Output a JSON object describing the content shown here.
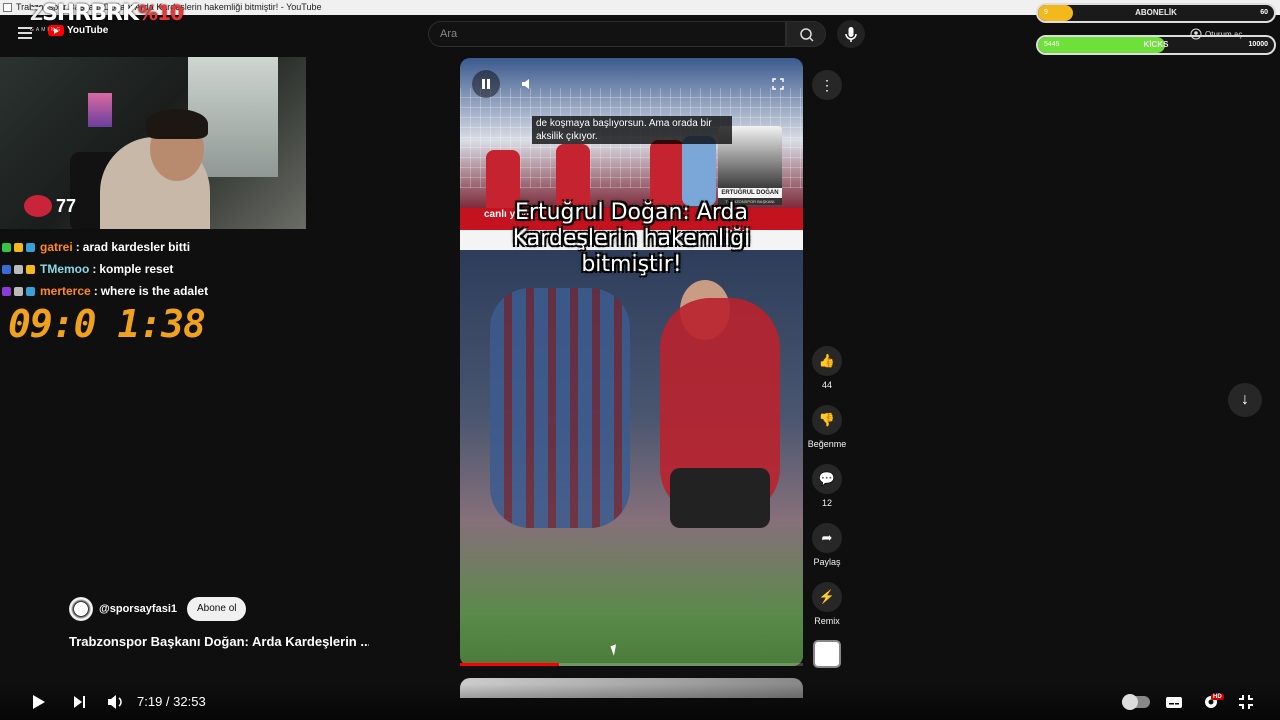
{
  "window": {
    "title": "Trabzonspor Başkanı Doğan: Arda Kardeşlerin hakemliği bitmiştir! - YouTube"
  },
  "header": {
    "logo_text": "YouTube",
    "search_placeholder": "Ara",
    "signin_label": "Oturum aç"
  },
  "stream_overlay": {
    "brand": "SHRBRK",
    "brand_pct": "%10",
    "brand_sub": "GAMING",
    "viewers": "77",
    "clock": "09:0 1:38",
    "bars": [
      {
        "label": "ABONELİK",
        "left_value": "9",
        "right_value": "60",
        "fill_fraction": 0.15,
        "color": "#f2b81c"
      },
      {
        "label": "KİCKS",
        "left_value": "5445",
        "right_value": "10000",
        "fill_fraction": 0.54,
        "color": "#6ee03a"
      }
    ],
    "chat": [
      {
        "user": "gatrei",
        "message": "arad kardesler bitti",
        "user_color": "#ff8a1e"
      },
      {
        "user": "TMemoo",
        "message": "komple reset",
        "user_color": "#8ad9e8"
      },
      {
        "user": "merterce",
        "message": "where is the adalet",
        "user_color": "#ff8a1e"
      }
    ]
  },
  "short": {
    "subtitle": "de koşmaya başlıyorsun. Ama orada bir aksilik çıkıyor.",
    "headline": "Ertuğrul Doğan: Arda Kardeşlerin hakemliği bitmiştir!",
    "live_label": "canlı yayın",
    "portrait_name": "ERTUĞRUL DOĞAN",
    "portrait_role": "TRABZONSPOR BAŞKANI",
    "progress_fraction": 0.29,
    "channel_handle": "@sporsayfasi1",
    "subscribe_label": "Abone ol",
    "title": "Trabzonspor Başkanı Doğan: Arda Kardeşlerin ..."
  },
  "actions": {
    "likes": "44",
    "dislike_label": "Beğenme",
    "comments": "12",
    "share_label": "Paylaş",
    "remix_label": "Remix"
  },
  "player": {
    "time": "7:19 / 32:53"
  }
}
